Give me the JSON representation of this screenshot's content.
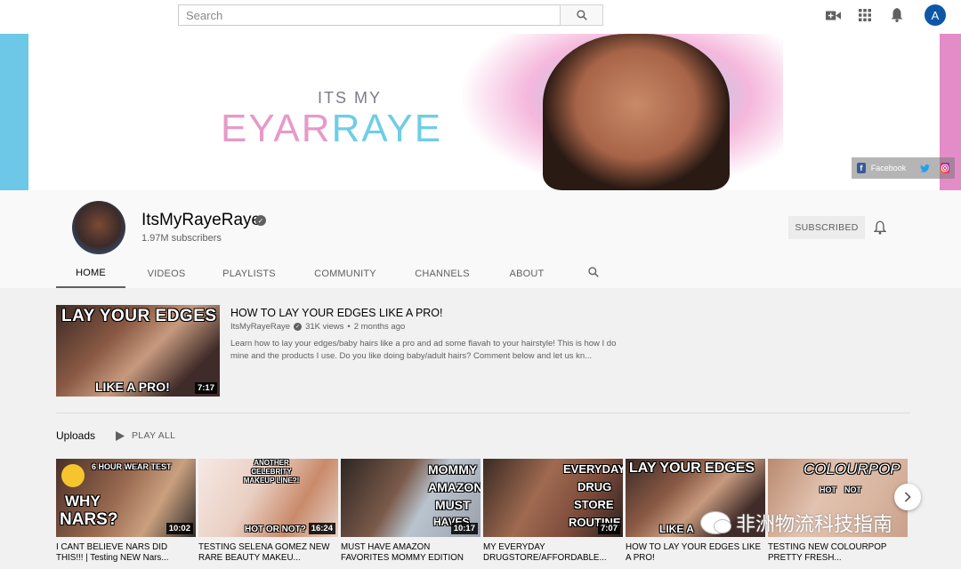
{
  "topbar": {
    "search_placeholder": "Search",
    "avatar_letter": "A"
  },
  "banner": {
    "brand_top": "ITS MY",
    "brand_left": "EYAR",
    "brand_right": "RAYE",
    "social": [
      "Facebook"
    ]
  },
  "channel": {
    "name": "ItsMyRayeRaye",
    "subscribers": "1.97M subscribers",
    "subscribe_label": "SUBSCRIBED",
    "tabs": [
      "HOME",
      "VIDEOS",
      "PLAYLISTS",
      "COMMUNITY",
      "CHANNELS",
      "ABOUT"
    ],
    "active_tab": "HOME"
  },
  "featured": {
    "thumb_line1": "LAY YOUR EDGES",
    "thumb_line2": "LIKE A PRO!",
    "duration": "7:17",
    "title": "HOW TO LAY YOUR EDGES LIKE A PRO!",
    "channel": "ItsMyRayeRaye",
    "views": "31K views",
    "age": "2 months ago",
    "description": "Learn how to lay your edges/baby hairs like a pro and ad some flavah to your hairstyle! This is how I do mine and the products I use. Do you like doing baby/adult hairs? Comment below and let us kn..."
  },
  "uploads": {
    "heading": "Uploads",
    "play_all": "PLAY ALL",
    "videos": [
      {
        "title": "I CANT BELIEVE NARS DID THIS!!! | Testing NEW Nars...",
        "duration": "10:02",
        "overlay": [
          "6 HOUR WEAR TEST",
          "WHY",
          "NARS?"
        ]
      },
      {
        "title": "TESTING SELENA GOMEZ NEW RARE BEAUTY MAKEU...",
        "duration": "16:24",
        "overlay": [
          "ANOTHER CELEBRITY MAKEUP LINE?!",
          "HOT OR NOT?"
        ]
      },
      {
        "title": "MUST HAVE AMAZON FAVORITES MOMMY EDITION",
        "duration": "10:17",
        "overlay": [
          "MOMMY",
          "AMAZON",
          "MUST",
          "HAVES"
        ]
      },
      {
        "title": "MY EVERYDAY DRUGSTORE/AFFORDABLE...",
        "duration": "7:07",
        "overlay": [
          "EVERYDAY",
          "DRUG",
          "STORE",
          "ROUTINE"
        ]
      },
      {
        "title": "HOW TO LAY YOUR EDGES LIKE A PRO!",
        "duration": "",
        "overlay": [
          "LAY YOUR EDGES",
          "LIKE A"
        ]
      },
      {
        "title": "TESTING NEW COLOURPOP PRETTY FRESH...",
        "duration": "",
        "overlay": [
          "COLOURPOP",
          "HOT",
          "NOT"
        ]
      }
    ]
  },
  "watermark": "非洲物流科技指南",
  "colors": {
    "brand_pink": "#e69ac8",
    "brand_blue": "#6fcde6",
    "avatar_blue": "#0d57a6"
  }
}
